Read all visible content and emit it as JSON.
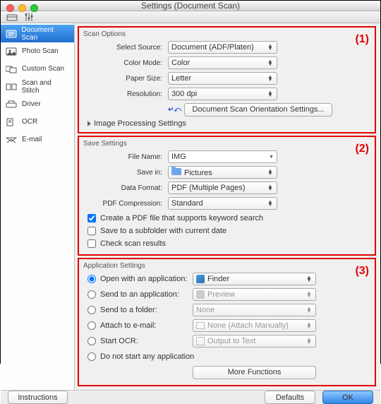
{
  "window": {
    "title": "Settings (Document Scan)"
  },
  "sidebar": {
    "items": [
      {
        "label": "Document Scan"
      },
      {
        "label": "Photo Scan"
      },
      {
        "label": "Custom Scan"
      },
      {
        "label": "Scan and Stitch"
      },
      {
        "label": "Driver"
      },
      {
        "label": "OCR"
      },
      {
        "label": "E-mail"
      }
    ]
  },
  "annot": {
    "s1": "(1)",
    "s2": "(2)",
    "s3": "(3)"
  },
  "scan": {
    "title": "Scan Options",
    "source_lbl": "Select Source:",
    "source_val": "Document (ADF/Platen)",
    "color_lbl": "Color Mode:",
    "color_val": "Color",
    "paper_lbl": "Paper Size:",
    "paper_val": "Letter",
    "res_lbl": "Resolution:",
    "res_val": "300 dpi",
    "orient_btn": "Document Scan Orientation Settings...",
    "disclosure": "Image Processing Settings"
  },
  "save": {
    "title": "Save Settings",
    "file_lbl": "File Name:",
    "file_val": "IMG",
    "savein_lbl": "Save in:",
    "savein_val": "Pictures",
    "fmt_lbl": "Data Format:",
    "fmt_val": "PDF (Multiple Pages)",
    "comp_lbl": "PDF Compression:",
    "comp_val": "Standard",
    "chk1": "Create a PDF file that supports keyword search",
    "chk2": "Save to a subfolder with current date",
    "chk3": "Check scan results"
  },
  "app": {
    "title": "Application Settings",
    "r1": "Open with an application:",
    "r1v": "Finder",
    "r2": "Send to an application:",
    "r2v": "Preview",
    "r3": "Send to a folder:",
    "r3v": "None",
    "r4": "Attach to e-mail:",
    "r4v": "None (Attach Manually)",
    "r5": "Start OCR:",
    "r5v": "Output to Text",
    "r6": "Do not start any application",
    "more": "More Functions"
  },
  "footer": {
    "instructions": "Instructions",
    "defaults": "Defaults",
    "ok": "OK"
  }
}
